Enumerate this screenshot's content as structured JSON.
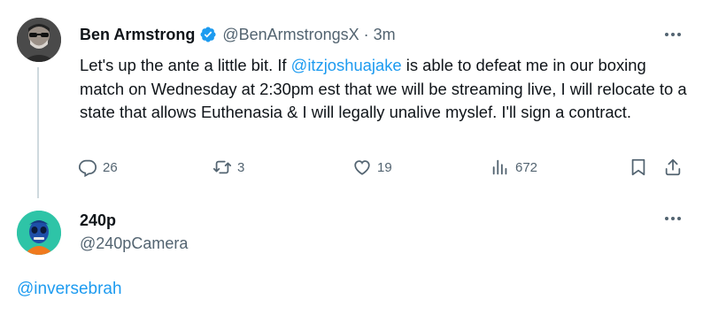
{
  "tweet1": {
    "display_name": "Ben Armstrong",
    "handle": "@BenArmstrongsX",
    "separator": "·",
    "time": "3m",
    "text_part1": "Let's up the ante a little bit. If ",
    "mention": "@itzjoshuajake",
    "text_part2": " is able to defeat me in our boxing match on Wednesday at 2:30pm est that we will be streaming live, I will relocate to a state that allows Euthenasia & I will legally unalive myslef. I'll sign a contract.",
    "replies": "26",
    "retweets": "3",
    "likes": "19",
    "views": "672",
    "verified_color": "#1d9bf0"
  },
  "tweet2": {
    "display_name": "240p",
    "handle": "@240pCamera",
    "reply_text": "@inversebrah"
  },
  "icons": {
    "reply": "reply-icon",
    "retweet": "retweet-icon",
    "like": "heart-icon",
    "views": "views-icon",
    "bookmark": "bookmark-icon",
    "share": "share-icon",
    "more": "more-icon",
    "verified": "verified-badge-icon"
  },
  "colors": {
    "link": "#1d9bf0",
    "secondary_text": "#536471",
    "primary_text": "#0f1419",
    "thread_line": "#cfd9de"
  }
}
